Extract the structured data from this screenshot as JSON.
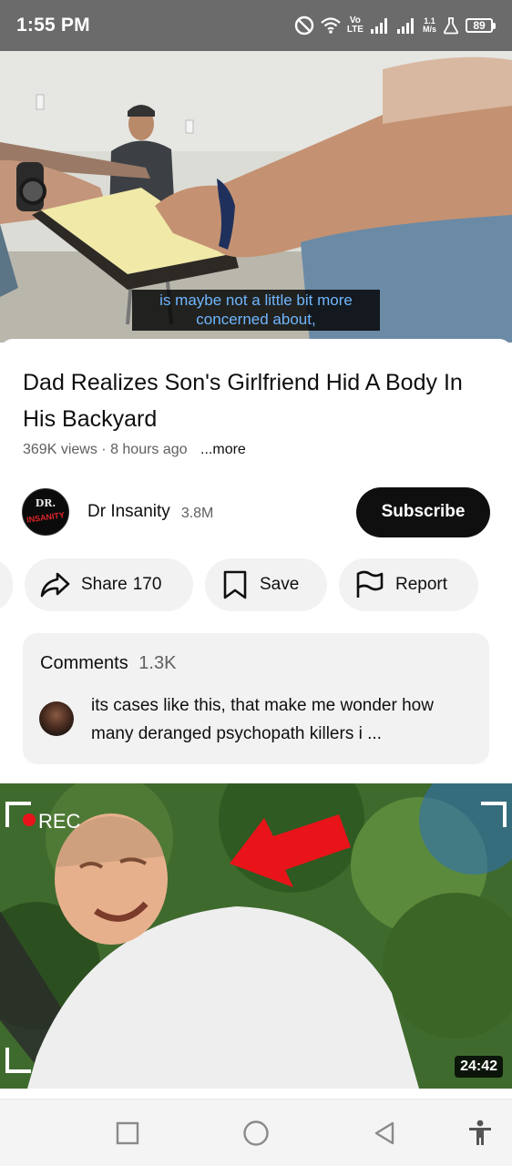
{
  "status_bar": {
    "time": "1:55 PM",
    "volte_top": "Vo",
    "volte_bottom": "LTE",
    "speed_value": "1.1",
    "speed_unit": "M/s",
    "battery": "89",
    "icons": [
      "dnd-icon",
      "wifi-icon",
      "signal-icon",
      "signal-icon",
      "lab-icon",
      "battery-icon"
    ]
  },
  "player": {
    "caption_line1": "is maybe not a little bit more",
    "caption_line2": "concerned about,"
  },
  "video": {
    "title": "Dad Realizes Son's Girlfriend Hid A Body In His Backyard",
    "views": "369K views",
    "separator": "·",
    "age": "8 hours ago",
    "more": "...more"
  },
  "channel": {
    "avatar_top": "DR.",
    "avatar_bottom": "INSANITY",
    "name": "Dr Insanity",
    "subscribers": "3.8M",
    "subscribe_label": "Subscribe"
  },
  "actions": {
    "share_label": "Share",
    "share_count": "170",
    "save_label": "Save",
    "report_label": "Report"
  },
  "comments": {
    "label": "Comments",
    "count": "1.3K",
    "top_comment": "its cases like this, that make me wonder how many deranged psychopath killers i ..."
  },
  "next_video": {
    "rec_label": "REC",
    "duration": "24:42"
  },
  "colors": {
    "status_bar_bg": "#6b6b6b",
    "caption_text": "#6fb6ff",
    "subscribe_bg": "#0f0f0f",
    "chip_bg": "#f2f2f2",
    "arrow_red": "#e8141a"
  }
}
